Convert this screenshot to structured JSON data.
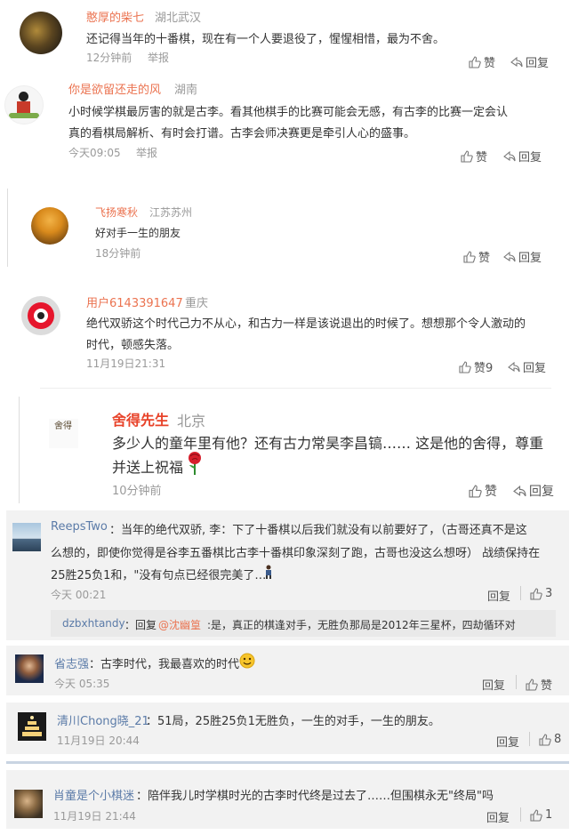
{
  "comments": [
    {
      "user": "憨厚的柴七",
      "location": "湖北武汉",
      "text": "还记得当年的十番棋，现在有一个人要退役了，惺惺相惜，最为不舍。",
      "time": "12分钟前",
      "report": "举报",
      "like": "赞",
      "reply": "回复"
    },
    {
      "user": "你是欲留还走的风",
      "location": "湖南",
      "text_line1": "小时候学棋最厉害的就是古李。看其他棋手的比赛可能会无感，有古李的比赛一定会认",
      "text_line2": "真的看棋局解析、有时会打谱。古李会师决赛更是牵引人心的盛事。",
      "time": "今天09:05",
      "report": "举报",
      "like": "赞",
      "reply": "回复"
    },
    {
      "user": "飞扬寒秋",
      "location": "江苏苏州",
      "text": "好对手一生的朋友",
      "time": "18分钟前",
      "like": "赞",
      "reply": "回复"
    },
    {
      "user": "用户6143391647",
      "location": "重庆",
      "text_line1": "绝代双骄这个时代己力不从心，和古力一样是该说退出的时候了。想想那个令人激动的",
      "text_line2": "时代，顿感失落。",
      "time": "11月19日21:31",
      "like": "赞9",
      "reply": "回复"
    },
    {
      "user": "舍得先生",
      "location": "北京",
      "avatar_text": "舍得",
      "text_line1": "多少人的童年里有他？还有古力常昊李昌镐……  这是他的舍得，尊重",
      "text_line2": "并送上祝福",
      "time": "10分钟前",
      "like": "赞",
      "reply": "回复"
    }
  ],
  "threads": [
    {
      "user": "ReepsTwo",
      "text_line1": "：当年的绝代双骄, 李：下了十番棋以后我们就没有以前要好了，（古哥还真不是这",
      "text_line2": "么想的，即使你觉得是谷李五番棋比古李十番棋印象深刻了跑，古哥也没这么想呀） 战绩保持在",
      "text_line3": "25胜25负1和，\"没有句点已经很完美了…\"",
      "time": "今天 00:21",
      "reply": "回复",
      "likes": "3",
      "sub_reply": {
        "user": "dzbxhtandy",
        "prefix": "：回复",
        "mention": "@沈幽篁",
        "text": ":是，真正的棋逢对手，无胜负那局是2012年三星杯，四劫循环对"
      }
    },
    {
      "user": "省志强",
      "text": "：古李时代，我最喜欢的时代",
      "time": "今天 05:35",
      "reply": "回复",
      "likes": "赞"
    },
    {
      "user": "清川Chong晓_21",
      "text": "：51局，25胜25负1无胜负，一生的对手，一生的朋友。",
      "time": "11月19日 20:44",
      "reply": "回复",
      "likes": "8"
    },
    {
      "user": "肖童是个小棋迷",
      "text": "：陪伴我儿时学棋时光的古李时代终是过去了……但围棋永无\"终局\"吗",
      "time": "11月19日 21:44",
      "reply": "回复",
      "likes": "1"
    }
  ]
}
